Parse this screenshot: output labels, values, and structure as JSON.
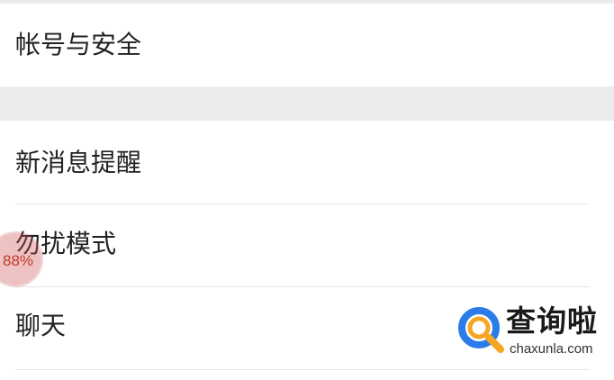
{
  "settings": {
    "items": [
      {
        "label": "帐号与安全"
      },
      {
        "label": "新消息提醒"
      },
      {
        "label": "勿扰模式"
      },
      {
        "label": "聊天"
      }
    ]
  },
  "overlay": {
    "progress_text": "88%",
    "progress_value": 0.88
  },
  "watermark": {
    "title": "查询啦",
    "url": "chaxunla.com",
    "icon": "magnifier-logo-icon",
    "colors": {
      "blue": "#2b7ce9",
      "orange": "#f5a623"
    }
  },
  "colors": {
    "background": "#ffffff",
    "section_gap": "#ebebeb",
    "divider": "#e6e6e6",
    "text": "#222222"
  }
}
